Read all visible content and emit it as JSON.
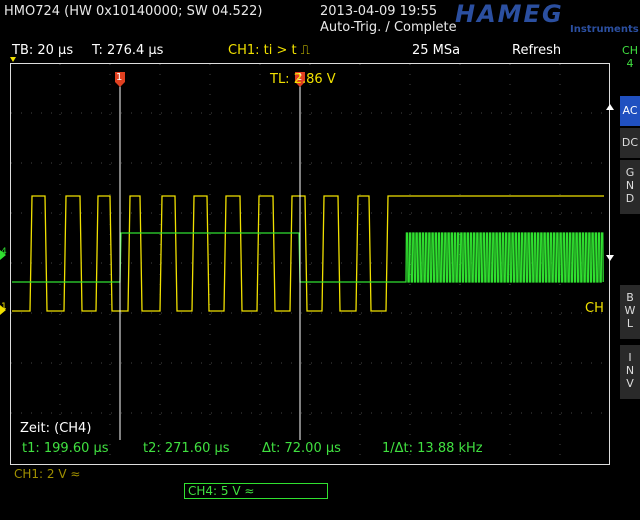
{
  "header": {
    "model": "HMO724 (HW 0x10140000; SW 04.522)",
    "datetime": "2013-04-09 19:55",
    "trigger_status": "Auto-Trig. / Complete",
    "logo": "HAMEG",
    "logo_sub": "Instruments"
  },
  "statusbar": {
    "timebase": "TB: 20 µs",
    "trigger_time": "T: 276.4 µs",
    "trigger_cond": "CH1: ti > t ⎍",
    "sample_rate": "25 MSa",
    "mode": "Refresh"
  },
  "side_menu": {
    "channel": "CH\n4",
    "items": [
      {
        "label": "AC",
        "active": true
      },
      {
        "label": "DC",
        "active": false
      },
      {
        "label": "G\nN\nD",
        "active": false
      },
      {
        "label": "B\nW\nL",
        "active": false
      },
      {
        "label": "I\nN\nV",
        "active": false
      }
    ]
  },
  "screen": {
    "trigger_level": "TL: 2.86 V",
    "cursor1_marker": "1",
    "cursor2_marker": "2",
    "ch_label_right": "CH",
    "ch1_ref": "1",
    "ch4_ref": "4",
    "zeit": "Zeit: (CH4)",
    "t1": "t1: 199.60 µs",
    "t2": "t2: 271.60 µs",
    "dt": "Δt: 72.00 µs",
    "freq": "1/Δt: 13.88 kHz"
  },
  "channels": {
    "ch1": "CH1: 2 V ≈",
    "ch4": "CH4: 5 V ≈"
  },
  "colors": {
    "ch1": "#f0e000",
    "ch4": "#30e030",
    "cursor_marker": "#e04020"
  }
}
